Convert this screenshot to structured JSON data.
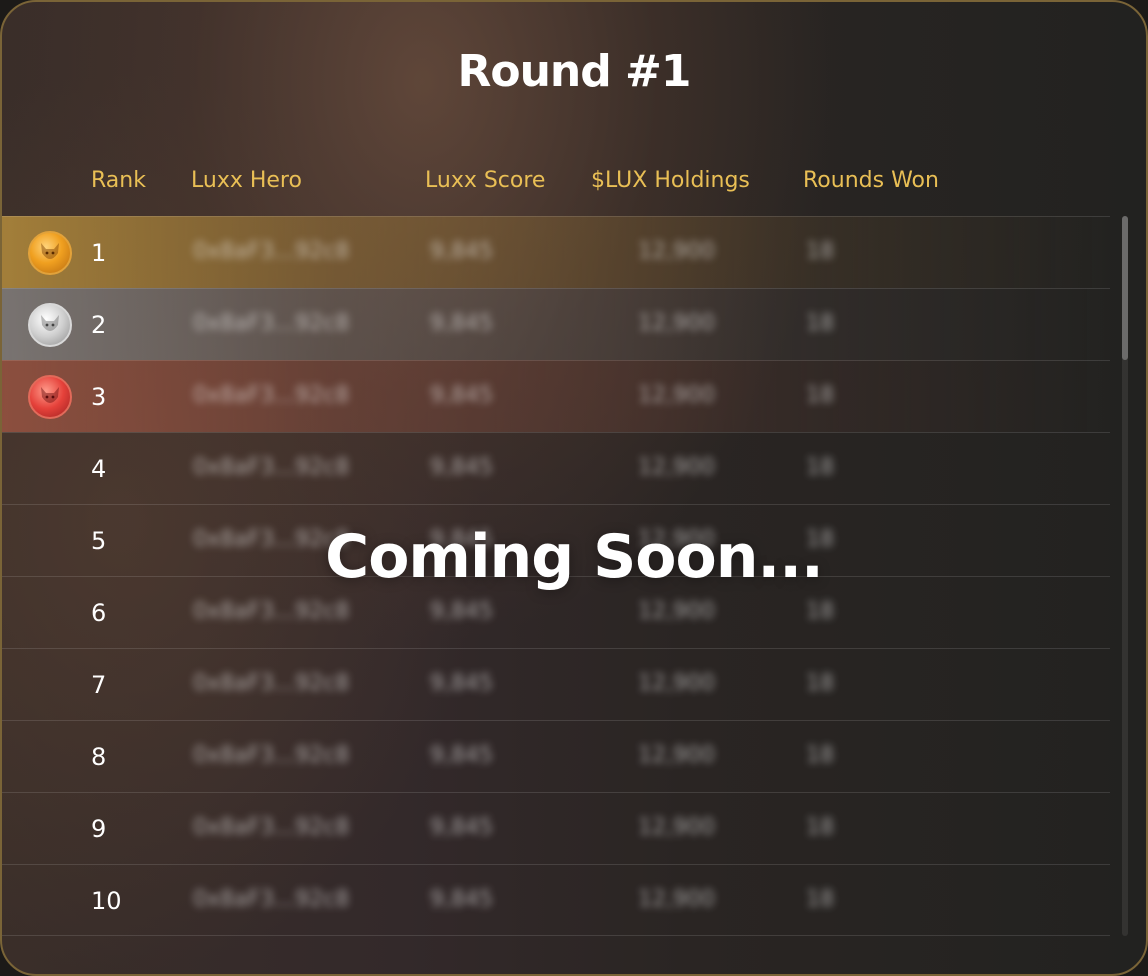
{
  "title": "Round #1",
  "overlay_text": "Coming Soon...",
  "columns": {
    "rank": "Rank",
    "hero": "Luxx Hero",
    "score": "Luxx Score",
    "holdings": "$LUX Holdings",
    "rounds_won": "Rounds Won"
  },
  "rows": [
    {
      "rank": "1",
      "hero": "0x8aF3...92c8",
      "score": "9,845",
      "holdings": "12,900",
      "won": "18",
      "medal": "gold-fox-medal-icon"
    },
    {
      "rank": "2",
      "hero": "0x8aF3...92c8",
      "score": "9,845",
      "holdings": "12,900",
      "won": "18",
      "medal": "silver-fox-medal-icon"
    },
    {
      "rank": "3",
      "hero": "0x8aF3...92c8",
      "score": "9,845",
      "holdings": "12,900",
      "won": "18",
      "medal": "bronze-fox-medal-icon"
    },
    {
      "rank": "4",
      "hero": "0x8aF3...92c8",
      "score": "9,845",
      "holdings": "12,900",
      "won": "18"
    },
    {
      "rank": "5",
      "hero": "0x8aF3...92c8",
      "score": "9,845",
      "holdings": "12,900",
      "won": "18"
    },
    {
      "rank": "6",
      "hero": "0x8aF3...92c8",
      "score": "9,845",
      "holdings": "12,900",
      "won": "18"
    },
    {
      "rank": "7",
      "hero": "0x8aF3...92c8",
      "score": "9,845",
      "holdings": "12,900",
      "won": "18"
    },
    {
      "rank": "8",
      "hero": "0x8aF3...92c8",
      "score": "9,845",
      "holdings": "12,900",
      "won": "18"
    },
    {
      "rank": "9",
      "hero": "0x8aF3...92c8",
      "score": "9,845",
      "holdings": "12,900",
      "won": "18"
    },
    {
      "rank": "10",
      "hero": "0x8aF3...92c8",
      "score": "9,845",
      "holdings": "12,900",
      "won": "18"
    }
  ],
  "colors": {
    "header_text": "#e9bf55",
    "border": "#7a6437",
    "gold_row": "#b48c3c",
    "silver_row": "#969696",
    "bronze_row": "#aa5a46"
  }
}
